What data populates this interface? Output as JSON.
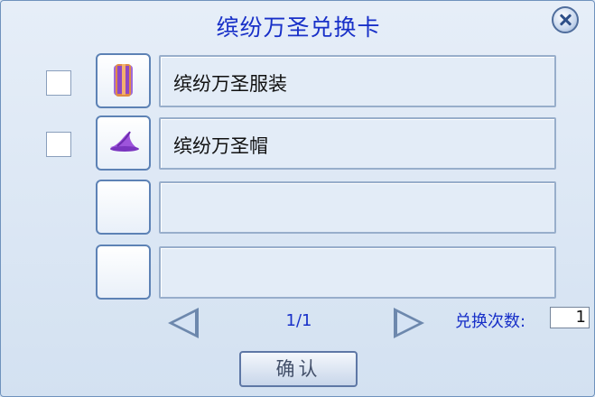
{
  "dialog": {
    "title": "缤纷万圣兑换卡",
    "close_icon": "close-circle-icon",
    "rows": [
      {
        "checked": false,
        "item_icon": "costume-icon",
        "label": "缤纷万圣服装"
      },
      {
        "checked": false,
        "item_icon": "witch-hat-icon",
        "label": "缤纷万圣帽"
      },
      {
        "checked": false,
        "item_icon": "",
        "label": ""
      },
      {
        "checked": false,
        "item_icon": "",
        "label": ""
      }
    ],
    "pagination": {
      "page": "1/1",
      "prev_icon": "left-arrow-icon",
      "next_icon": "right-arrow-icon"
    },
    "exchange_count_label": "兑换次数:",
    "exchange_count_value": "1",
    "confirm_label": "确认",
    "colors": {
      "title": "#1830c8",
      "panel": "#dbe7f4",
      "border": "#5d82b5"
    }
  }
}
